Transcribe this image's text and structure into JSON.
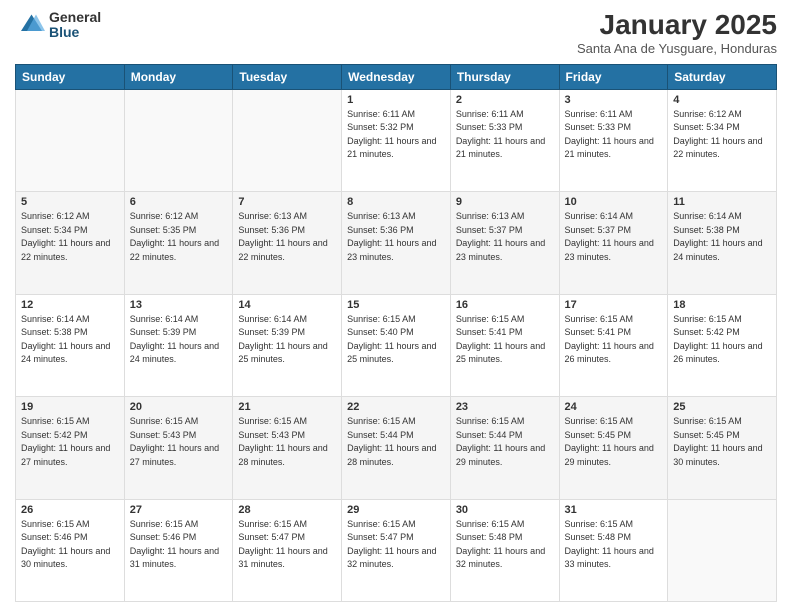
{
  "logo": {
    "general": "General",
    "blue": "Blue"
  },
  "header": {
    "month": "January 2025",
    "location": "Santa Ana de Yusguare, Honduras"
  },
  "weekdays": [
    "Sunday",
    "Monday",
    "Tuesday",
    "Wednesday",
    "Thursday",
    "Friday",
    "Saturday"
  ],
  "weeks": [
    [
      {
        "day": "",
        "info": ""
      },
      {
        "day": "",
        "info": ""
      },
      {
        "day": "",
        "info": ""
      },
      {
        "day": "1",
        "sunrise": "6:11 AM",
        "sunset": "5:32 PM",
        "daylight": "11 hours and 21 minutes."
      },
      {
        "day": "2",
        "sunrise": "6:11 AM",
        "sunset": "5:33 PM",
        "daylight": "11 hours and 21 minutes."
      },
      {
        "day": "3",
        "sunrise": "6:11 AM",
        "sunset": "5:33 PM",
        "daylight": "11 hours and 21 minutes."
      },
      {
        "day": "4",
        "sunrise": "6:12 AM",
        "sunset": "5:34 PM",
        "daylight": "11 hours and 22 minutes."
      }
    ],
    [
      {
        "day": "5",
        "sunrise": "6:12 AM",
        "sunset": "5:34 PM",
        "daylight": "11 hours and 22 minutes."
      },
      {
        "day": "6",
        "sunrise": "6:12 AM",
        "sunset": "5:35 PM",
        "daylight": "11 hours and 22 minutes."
      },
      {
        "day": "7",
        "sunrise": "6:13 AM",
        "sunset": "5:36 PM",
        "daylight": "11 hours and 22 minutes."
      },
      {
        "day": "8",
        "sunrise": "6:13 AM",
        "sunset": "5:36 PM",
        "daylight": "11 hours and 23 minutes."
      },
      {
        "day": "9",
        "sunrise": "6:13 AM",
        "sunset": "5:37 PM",
        "daylight": "11 hours and 23 minutes."
      },
      {
        "day": "10",
        "sunrise": "6:14 AM",
        "sunset": "5:37 PM",
        "daylight": "11 hours and 23 minutes."
      },
      {
        "day": "11",
        "sunrise": "6:14 AM",
        "sunset": "5:38 PM",
        "daylight": "11 hours and 24 minutes."
      }
    ],
    [
      {
        "day": "12",
        "sunrise": "6:14 AM",
        "sunset": "5:38 PM",
        "daylight": "11 hours and 24 minutes."
      },
      {
        "day": "13",
        "sunrise": "6:14 AM",
        "sunset": "5:39 PM",
        "daylight": "11 hours and 24 minutes."
      },
      {
        "day": "14",
        "sunrise": "6:14 AM",
        "sunset": "5:39 PM",
        "daylight": "11 hours and 25 minutes."
      },
      {
        "day": "15",
        "sunrise": "6:15 AM",
        "sunset": "5:40 PM",
        "daylight": "11 hours and 25 minutes."
      },
      {
        "day": "16",
        "sunrise": "6:15 AM",
        "sunset": "5:41 PM",
        "daylight": "11 hours and 25 minutes."
      },
      {
        "day": "17",
        "sunrise": "6:15 AM",
        "sunset": "5:41 PM",
        "daylight": "11 hours and 26 minutes."
      },
      {
        "day": "18",
        "sunrise": "6:15 AM",
        "sunset": "5:42 PM",
        "daylight": "11 hours and 26 minutes."
      }
    ],
    [
      {
        "day": "19",
        "sunrise": "6:15 AM",
        "sunset": "5:42 PM",
        "daylight": "11 hours and 27 minutes."
      },
      {
        "day": "20",
        "sunrise": "6:15 AM",
        "sunset": "5:43 PM",
        "daylight": "11 hours and 27 minutes."
      },
      {
        "day": "21",
        "sunrise": "6:15 AM",
        "sunset": "5:43 PM",
        "daylight": "11 hours and 28 minutes."
      },
      {
        "day": "22",
        "sunrise": "6:15 AM",
        "sunset": "5:44 PM",
        "daylight": "11 hours and 28 minutes."
      },
      {
        "day": "23",
        "sunrise": "6:15 AM",
        "sunset": "5:44 PM",
        "daylight": "11 hours and 29 minutes."
      },
      {
        "day": "24",
        "sunrise": "6:15 AM",
        "sunset": "5:45 PM",
        "daylight": "11 hours and 29 minutes."
      },
      {
        "day": "25",
        "sunrise": "6:15 AM",
        "sunset": "5:45 PM",
        "daylight": "11 hours and 30 minutes."
      }
    ],
    [
      {
        "day": "26",
        "sunrise": "6:15 AM",
        "sunset": "5:46 PM",
        "daylight": "11 hours and 30 minutes."
      },
      {
        "day": "27",
        "sunrise": "6:15 AM",
        "sunset": "5:46 PM",
        "daylight": "11 hours and 31 minutes."
      },
      {
        "day": "28",
        "sunrise": "6:15 AM",
        "sunset": "5:47 PM",
        "daylight": "11 hours and 31 minutes."
      },
      {
        "day": "29",
        "sunrise": "6:15 AM",
        "sunset": "5:47 PM",
        "daylight": "11 hours and 32 minutes."
      },
      {
        "day": "30",
        "sunrise": "6:15 AM",
        "sunset": "5:48 PM",
        "daylight": "11 hours and 32 minutes."
      },
      {
        "day": "31",
        "sunrise": "6:15 AM",
        "sunset": "5:48 PM",
        "daylight": "11 hours and 33 minutes."
      },
      {
        "day": "",
        "info": ""
      }
    ]
  ]
}
